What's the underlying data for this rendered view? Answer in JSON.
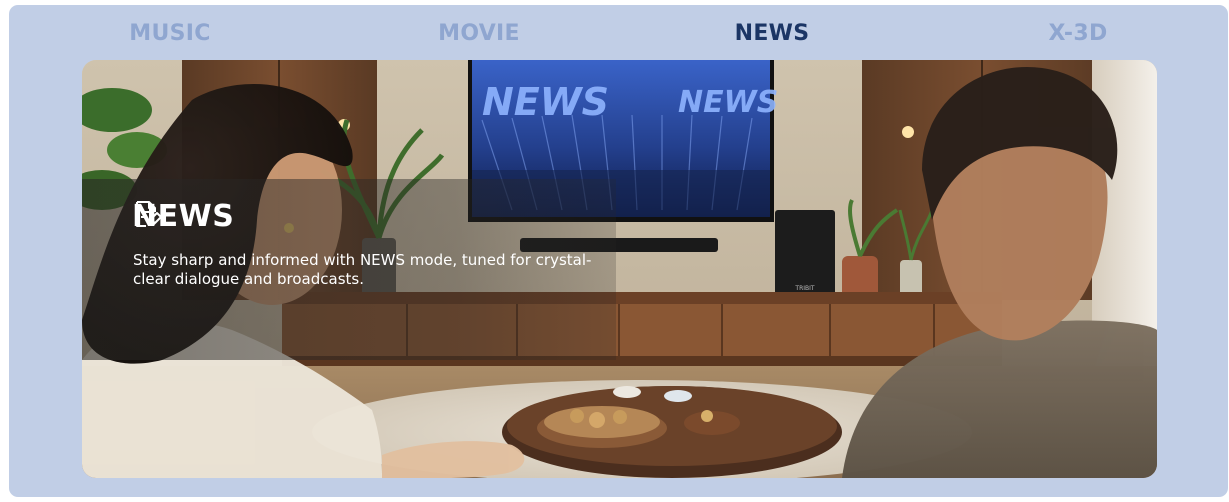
{
  "tabs": [
    {
      "label": "MUSIC",
      "active": false
    },
    {
      "label": "MOVIE",
      "active": false
    },
    {
      "label": "NEWS",
      "active": true
    },
    {
      "label": "X-3D",
      "active": false
    }
  ],
  "feature": {
    "title": "NEWS",
    "icon": "edit-document-icon",
    "description": "Stay sharp and informed with NEWS mode, tuned for crystal-clear dialogue and broadcasts."
  },
  "scene": {
    "tv_screen_text": "NEWS",
    "speaker_brand": "TRIBIT"
  },
  "colors": {
    "panel_bg": "#c1cee6",
    "tab_inactive": "#8fa6d0",
    "tab_active": "#1b3565",
    "caption_text": "#ffffff"
  }
}
